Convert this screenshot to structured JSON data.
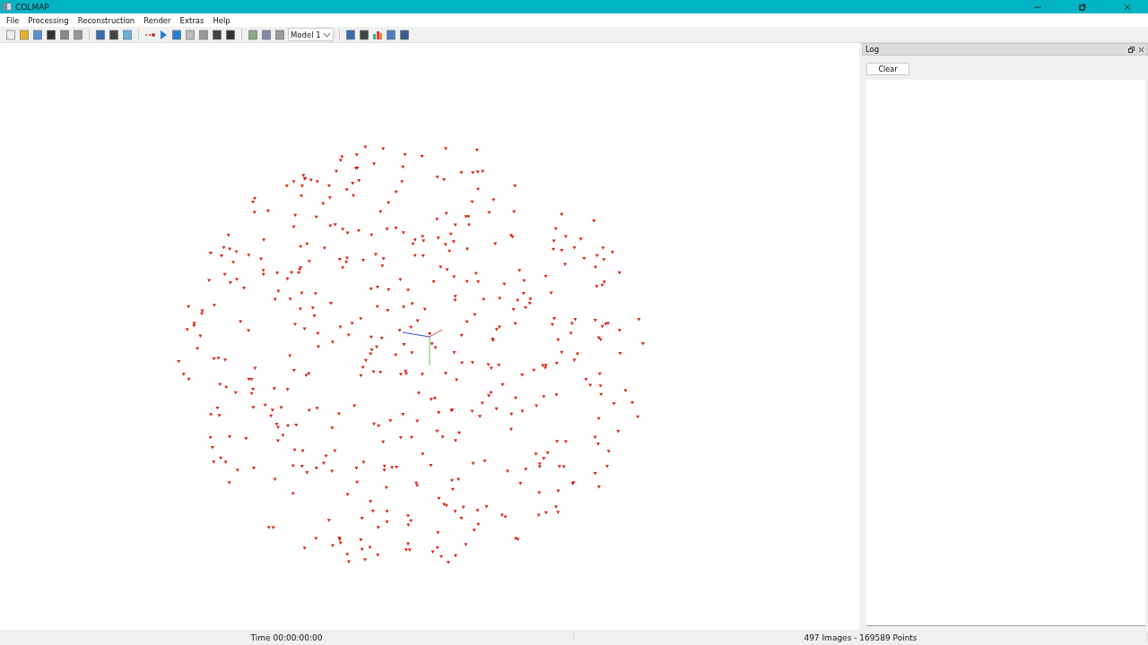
{
  "window": {
    "title": "COLMAP"
  },
  "menu": [
    "File",
    "Processing",
    "Reconstruction",
    "Render",
    "Extras",
    "Help"
  ],
  "toolbar": {
    "model_select": {
      "value": "Model 1"
    }
  },
  "log_panel": {
    "title": "Log",
    "clear_button": "Clear"
  },
  "status_bar": {
    "time": "Time 00:00:00:00",
    "summary": "497 Images - 169589 Points"
  }
}
